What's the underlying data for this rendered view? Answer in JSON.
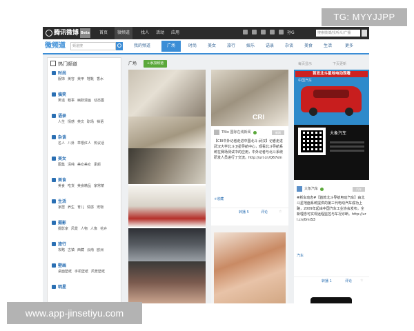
{
  "watermarks": {
    "top": "TG: MYYJJPP",
    "bottom": "www.app-jinsetiyu.com"
  },
  "topbar": {
    "logo_text": "腾讯微博",
    "logo_badge": "Beta",
    "nav": [
      "首页",
      "微频道",
      "找人",
      "活动",
      "应用"
    ],
    "selected_nav": "微频道",
    "user": "孙G",
    "search_placeholder": "搜索微博/找听众/广播"
  },
  "channelbar": {
    "brand": "微频道",
    "search_placeholder": "频道搜",
    "tabs": [
      "我的频道",
      "广场",
      "时尚",
      "美女",
      "旅行",
      "娱乐",
      "语录",
      "杂谈",
      "美食",
      "生活",
      "更多"
    ],
    "active_tab": "广场"
  },
  "sidebar": {
    "title": "热门频道",
    "groups": [
      {
        "title": "时尚",
        "items": [
          "服饰",
          "美容",
          "美甲",
          "鞋靴",
          "香水"
        ]
      },
      {
        "title": "搞笑",
        "items": [
          "笑话",
          "糗事",
          "幽默漫画",
          "动态图"
        ]
      },
      {
        "title": "语录",
        "items": [
          "人生",
          "情感",
          "英文",
          "职场",
          "禅语"
        ]
      },
      {
        "title": "杂谈",
        "items": [
          "名人",
          "八卦",
          "草根红人",
          "热议话"
        ]
      },
      {
        "title": "美女",
        "items": [
          "图集",
          "清纯",
          "美女美女",
          "素颜"
        ]
      },
      {
        "title": "美食",
        "items": [
          "美食",
          "吃货",
          "美食精品",
          "家常菜"
        ]
      },
      {
        "title": "生活",
        "items": [
          "家居",
          "养生",
          "育儿",
          "情感",
          "宠物"
        ]
      },
      {
        "title": "摄影",
        "items": [
          "摄影家",
          "风景",
          "人物",
          "人像",
          "花卉"
        ]
      },
      {
        "title": "旅行",
        "items": [
          "攻略",
          "古镇",
          "西藏",
          "云南",
          "欧洲"
        ]
      },
      {
        "title": "壁画",
        "items": [
          "桌面壁纸",
          "手机壁纸",
          "风景壁纸"
        ]
      },
      {
        "title": "明星",
        "items": []
      }
    ]
  },
  "main": {
    "breadcrumb": "广场",
    "add_button": "+添加频道",
    "meta_left": "每页显示",
    "meta_right": "下页更新"
  },
  "post_col2": {
    "author": "TBio 国际在线新闻",
    "tag": "新闻",
    "image_badge": "CRI",
    "text": "【CRI中外记者走进中国北斗·武汉】记者走进武汉大学北斗卫星导航中心，观看北斗导航系统在赛场测试中的应用，中外记者与北斗系统研发人员进行了交流。http://url.cn/Q67xln",
    "link": "+收藏",
    "foot_left": "转播 5",
    "foot_mid": "评论"
  },
  "post_col3": {
    "ad_title": "首发北斗星地电动观看",
    "ad_sub": "中国汽车",
    "ad_brand": "大象汽车",
    "author": "大象汽车",
    "tag": "汽车",
    "text": "#新车动态#【首款北斗导航电动汽车】由北斗星地面系统提供的第三代电动汽车成功上路，2009年起由中国汽车工业协会发布，全新理念可实现远程监控与车况诊断。http://url.cn/0mtS3",
    "label": "汽车",
    "foot_left": "转播 1",
    "foot_mid": "评论"
  },
  "colors": {
    "accent": "#3b8dd6",
    "topbar": "#2b2b2b",
    "green": "#5aa83a"
  }
}
